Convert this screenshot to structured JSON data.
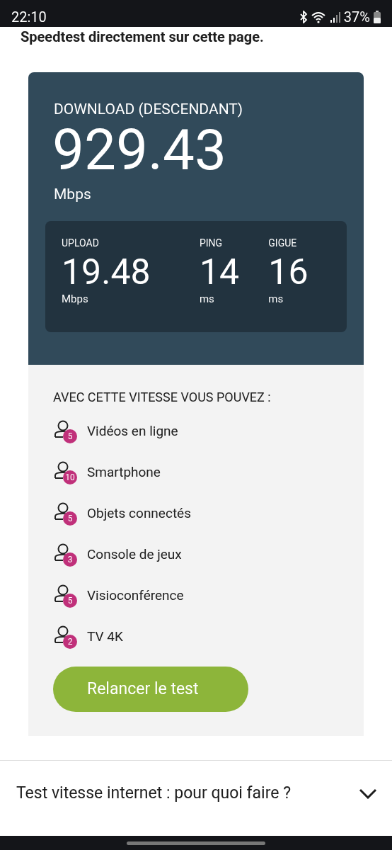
{
  "status_bar": {
    "time": "22:10",
    "battery": "37%"
  },
  "intro": "Speedtest directement sur cette page.",
  "result": {
    "download_label": "DOWNLOAD (DESCENDANT)",
    "download_value": "929.43",
    "download_unit": "Mbps",
    "metrics": [
      {
        "label": "UPLOAD",
        "value": "19.48",
        "unit": "Mbps"
      },
      {
        "label": "PING",
        "value": "14",
        "unit": "ms"
      },
      {
        "label": "GIGUE",
        "value": "16",
        "unit": "ms"
      }
    ]
  },
  "usage": {
    "title": "AVEC CETTE VITESSE VOUS POUVEZ :",
    "items": [
      {
        "label": "Vidéos en ligne",
        "count": "5"
      },
      {
        "label": "Smartphone",
        "count": "10"
      },
      {
        "label": "Objets connectés",
        "count": "5"
      },
      {
        "label": "Console de jeux",
        "count": "3"
      },
      {
        "label": "Visioconférence",
        "count": "5"
      },
      {
        "label": "TV 4K",
        "count": "2"
      }
    ],
    "button": "Relancer le test"
  },
  "faq": {
    "question": "Test vitesse internet : pour quoi faire ?",
    "expanded": false
  }
}
